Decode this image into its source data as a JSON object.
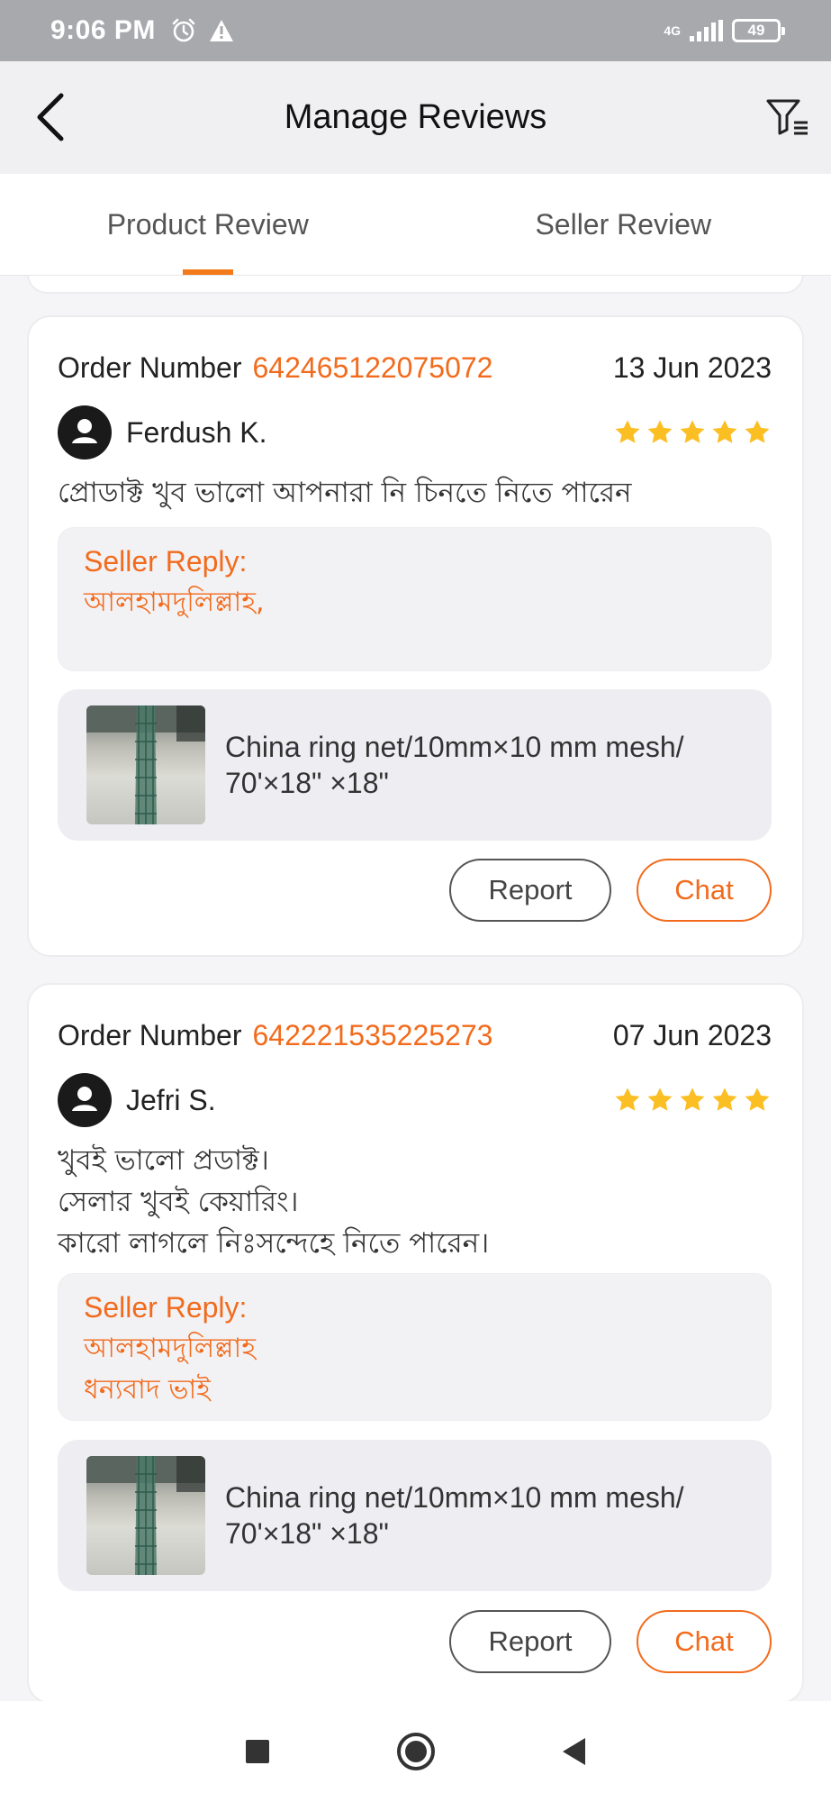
{
  "status_bar": {
    "time": "9:06 PM",
    "network": "4G",
    "battery": "49",
    "icons": [
      "alarm-icon",
      "warning-icon",
      "signal-icon",
      "battery-icon"
    ]
  },
  "header": {
    "title": "Manage Reviews",
    "back_icon": "chevron-left-icon",
    "filter_icon": "filter-icon"
  },
  "tabs": [
    {
      "label": "Product Review",
      "active": true
    },
    {
      "label": "Seller Review",
      "active": false
    }
  ],
  "colors": {
    "accent": "#f26b1d",
    "star": "#fbbf24",
    "tab_indicator": "#f27a1a"
  },
  "reviews": [
    {
      "order_label": "Order Number",
      "order_number": "642465122075072",
      "date": "13 Jun 2023",
      "reviewer": "Ferdush K.",
      "rating": 5,
      "text": "প্রোডাক্ট খুব ভালো আপনারা নি চিনতে নিতে পারেন",
      "reply_title": "Seller Reply:",
      "reply_text": "আলহামদুলিল্লাহ,",
      "product_name": "China ring net/10mm×10 mm mesh/ 70'×18\" ×18\"",
      "report_label": "Report",
      "chat_label": "Chat"
    },
    {
      "order_label": "Order Number",
      "order_number": "642221535225273",
      "date": "07 Jun 2023",
      "reviewer": "Jefri S.",
      "rating": 5,
      "text_lines": [
        "খুবই ভালো প্রডাক্ট।",
        "সেলার খুবই কেয়ারিং।",
        "কারো লাগলে নিঃসন্দেহে নিতে পারেন।"
      ],
      "reply_title": "Seller Reply:",
      "reply_lines": [
        "আলহামদুলিল্লাহ",
        "ধন্যবাদ ভাই"
      ],
      "product_name": "China ring net/10mm×10 mm mesh/ 70'×18\" ×18\"",
      "report_label": "Report",
      "chat_label": "Chat"
    }
  ],
  "nav_bar": {
    "icons": [
      "recents-square-icon",
      "home-circle-icon",
      "back-triangle-icon"
    ]
  }
}
